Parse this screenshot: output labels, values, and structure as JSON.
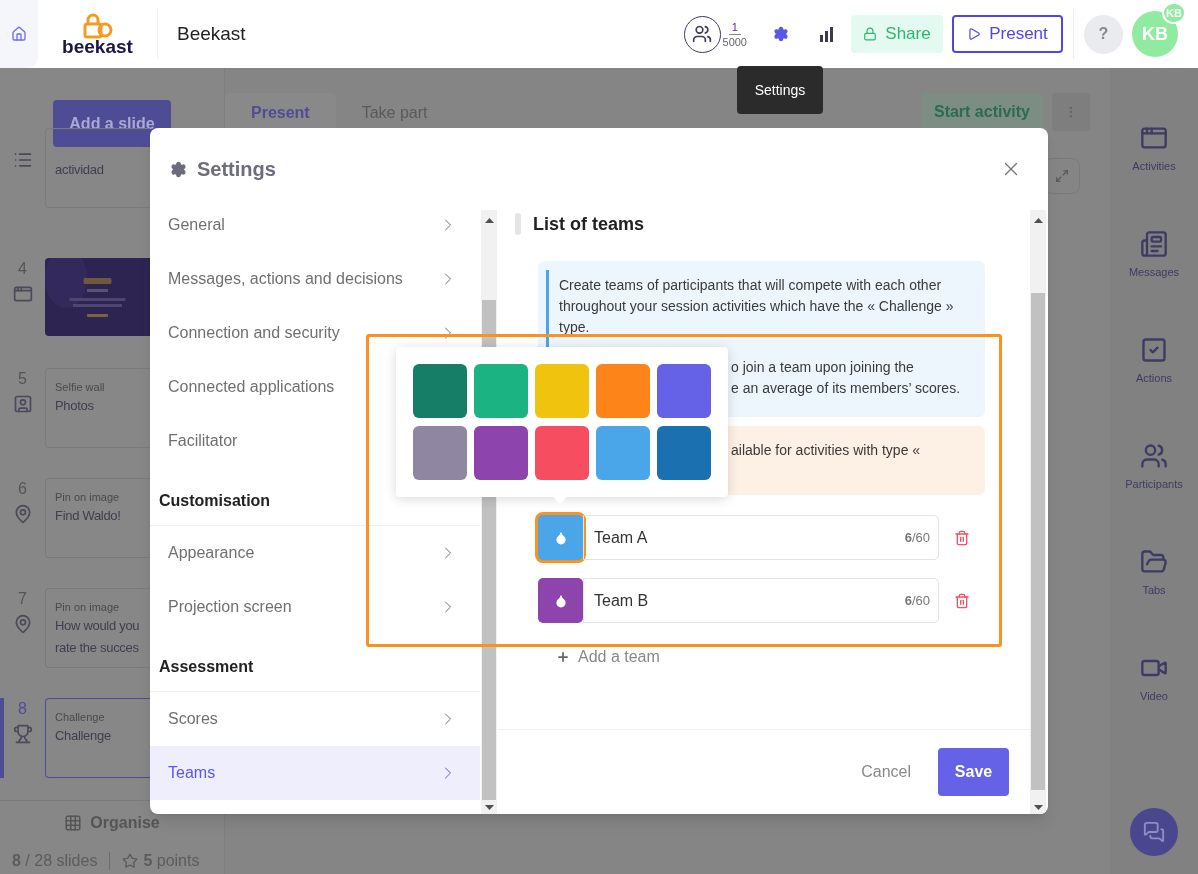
{
  "top_bar": {
    "logo": "beekast",
    "title": "Beekast",
    "participants": {
      "count": "1",
      "limit": "5000"
    },
    "share": "Share",
    "present": "Present",
    "help": "?",
    "avatar": "KB",
    "avatar_badge": "KB"
  },
  "tooltip": "Settings",
  "slide_panel": {
    "add_button": "Add a slide",
    "slides": [
      {
        "kind": "form",
        "title": "actividad",
        "selected": false
      },
      {
        "number": "4",
        "kind": "thumbnail",
        "selected": false
      },
      {
        "number": "5",
        "kind": "selfie",
        "type_label": "Selfie wall",
        "title": "Photos",
        "selected": false
      },
      {
        "number": "6",
        "kind": "pin",
        "type_label": "Pin on image",
        "title": "Find Waldo!",
        "selected": false
      },
      {
        "number": "7",
        "kind": "pin",
        "type_label": "Pin on image",
        "title": "How would you\nrate the succes",
        "selected": false
      },
      {
        "number": "8",
        "kind": "challenge",
        "type_label": "Challenge",
        "title": "Challenge",
        "selected": true
      }
    ],
    "organise": "Organise",
    "slide_count": "**8** / 28 slides",
    "points": "**5** points"
  },
  "stage": {
    "tabs": [
      {
        "label": "Present",
        "selected": true
      },
      {
        "label": "Take part",
        "selected": false
      }
    ],
    "start_button": "Start activity"
  },
  "right_sidebar": [
    {
      "kind": "activities",
      "label": "Activities"
    },
    {
      "kind": "messages",
      "label": "Messages"
    },
    {
      "kind": "actions",
      "label": "Actions"
    },
    {
      "kind": "participants",
      "label": "Participants"
    },
    {
      "kind": "tabs",
      "label": "Tabs"
    },
    {
      "kind": "video",
      "label": "Video"
    }
  ],
  "modal": {
    "title": "Settings",
    "nav": [
      {
        "items": [
          {
            "label": "General",
            "selected": false
          },
          {
            "label": "Messages, actions and decisions",
            "selected": false
          },
          {
            "label": "Connection and security",
            "selected": false
          },
          {
            "label": "Connected applications",
            "selected": false
          },
          {
            "label": "Facilitator",
            "selected": false
          }
        ]
      },
      {
        "heading": "Customisation",
        "items": [
          {
            "label": "Appearance",
            "selected": false
          },
          {
            "label": "Projection screen",
            "selected": false
          }
        ]
      },
      {
        "heading": "Assessment",
        "items": [
          {
            "label": "Scores",
            "selected": false
          },
          {
            "label": "Teams",
            "selected": true
          }
        ]
      }
    ],
    "content": {
      "heading": "List of teams",
      "info": "Create teams of participants that will compete with each other throughout your session activities which have the « Challenge » type.",
      "info_fragment": "o join a team upon joining the\ne an average of its members’ scores.",
      "warning_fragment": "ailable for activities with type «",
      "teams": [
        {
          "name": "Team A",
          "color": "#4aa6e9",
          "counter": "**6**/60",
          "selected": true
        },
        {
          "name": "Team B",
          "color": "#8e44ad",
          "counter": "**6**/60",
          "selected": false
        }
      ],
      "add_team": "Add a team"
    },
    "color_picker": [
      {
        "color": "#167d67"
      },
      {
        "color": "#1bb381"
      },
      {
        "color": "#f0c30f"
      },
      {
        "color": "#fd8418"
      },
      {
        "color": "#6562e8"
      },
      {
        "color": "#8f87a1"
      },
      {
        "color": "#8e44ad"
      },
      {
        "color": "#f64e60"
      },
      {
        "color": "#4aa6e9"
      },
      {
        "color": "#1b70b0"
      }
    ],
    "cancel": "Cancel",
    "save": "Save"
  }
}
